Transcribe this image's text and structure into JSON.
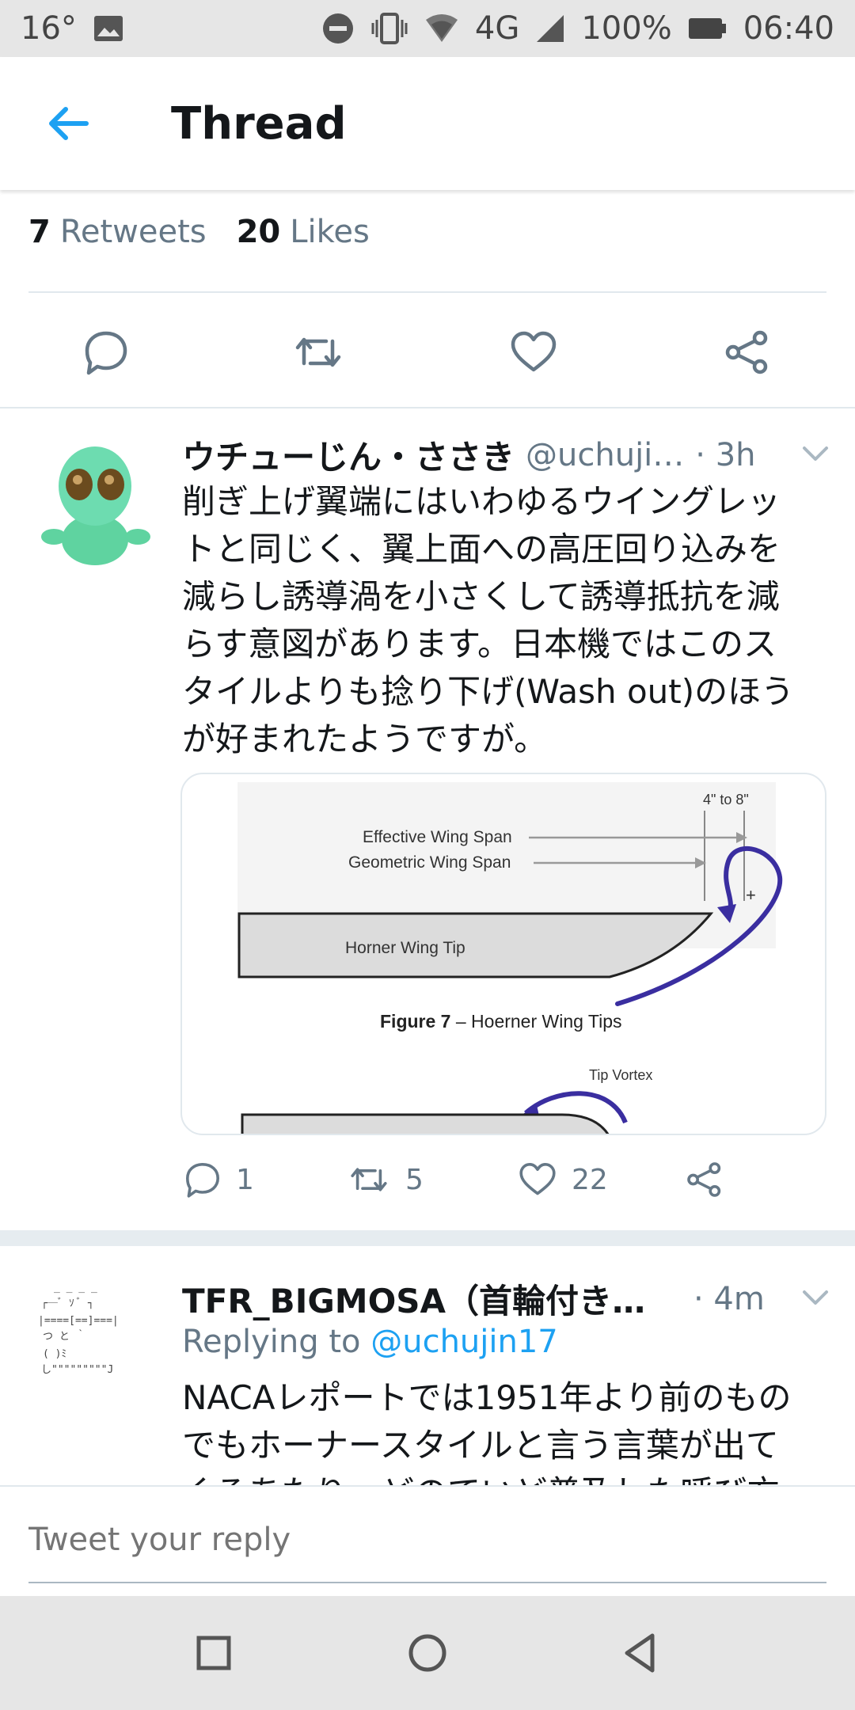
{
  "status_bar": {
    "temperature": "16°",
    "network": "4G",
    "battery": "100%",
    "time": "06:40"
  },
  "app_bar": {
    "title": "Thread"
  },
  "stats": {
    "retweets_count": "7",
    "retweets_label": "Retweets",
    "likes_count": "20",
    "likes_label": "Likes"
  },
  "tweet1": {
    "name": "ウチューじん・ささき",
    "handle": "@uchuji…",
    "time": "· 3h",
    "text_lines": [
      "削ぎ上げ翼端にはいわゆるウイングレッ",
      "トと同じく、翼上面への高圧回り込みを",
      "減らし誘導渦を小さくして誘導抵抗を減",
      "らす意図があります。日本機ではこのス",
      "タイルよりも捻り下げ(Wash out)のほう",
      "が好まれたようですが。"
    ],
    "media": {
      "dimension_label": "4\" to 8\"",
      "effective_span_label": "Effective Wing Span",
      "geometric_span_label": "Geometric Wing Span",
      "wing_label": "Horner Wing Tip",
      "figure_bold": "Figure 7",
      "figure_rest": " – Hoerner Wing Tips",
      "vortex_label": "Tip Vortex",
      "plus": "+"
    },
    "reply_count": "1",
    "retweet_count": "5",
    "like_count": "22"
  },
  "tweet2": {
    "name": "TFR_BIGMOSA（首輪付きの…",
    "time": "· 4m",
    "replying_prefix": "Replying to ",
    "replying_handle": "@uchujin17",
    "text_lines": [
      "NACAレポートでは1951年より前のもの",
      "でもホーナースタイルと言う言葉が出て",
      "くるあたり…どのていど普及した呼び方"
    ]
  },
  "reply_bar": {
    "placeholder": "Tweet your reply"
  },
  "colors": {
    "accent": "#1da1f2",
    "muted": "#657786",
    "text": "#14171a",
    "vortex": "#3a2ea0"
  }
}
